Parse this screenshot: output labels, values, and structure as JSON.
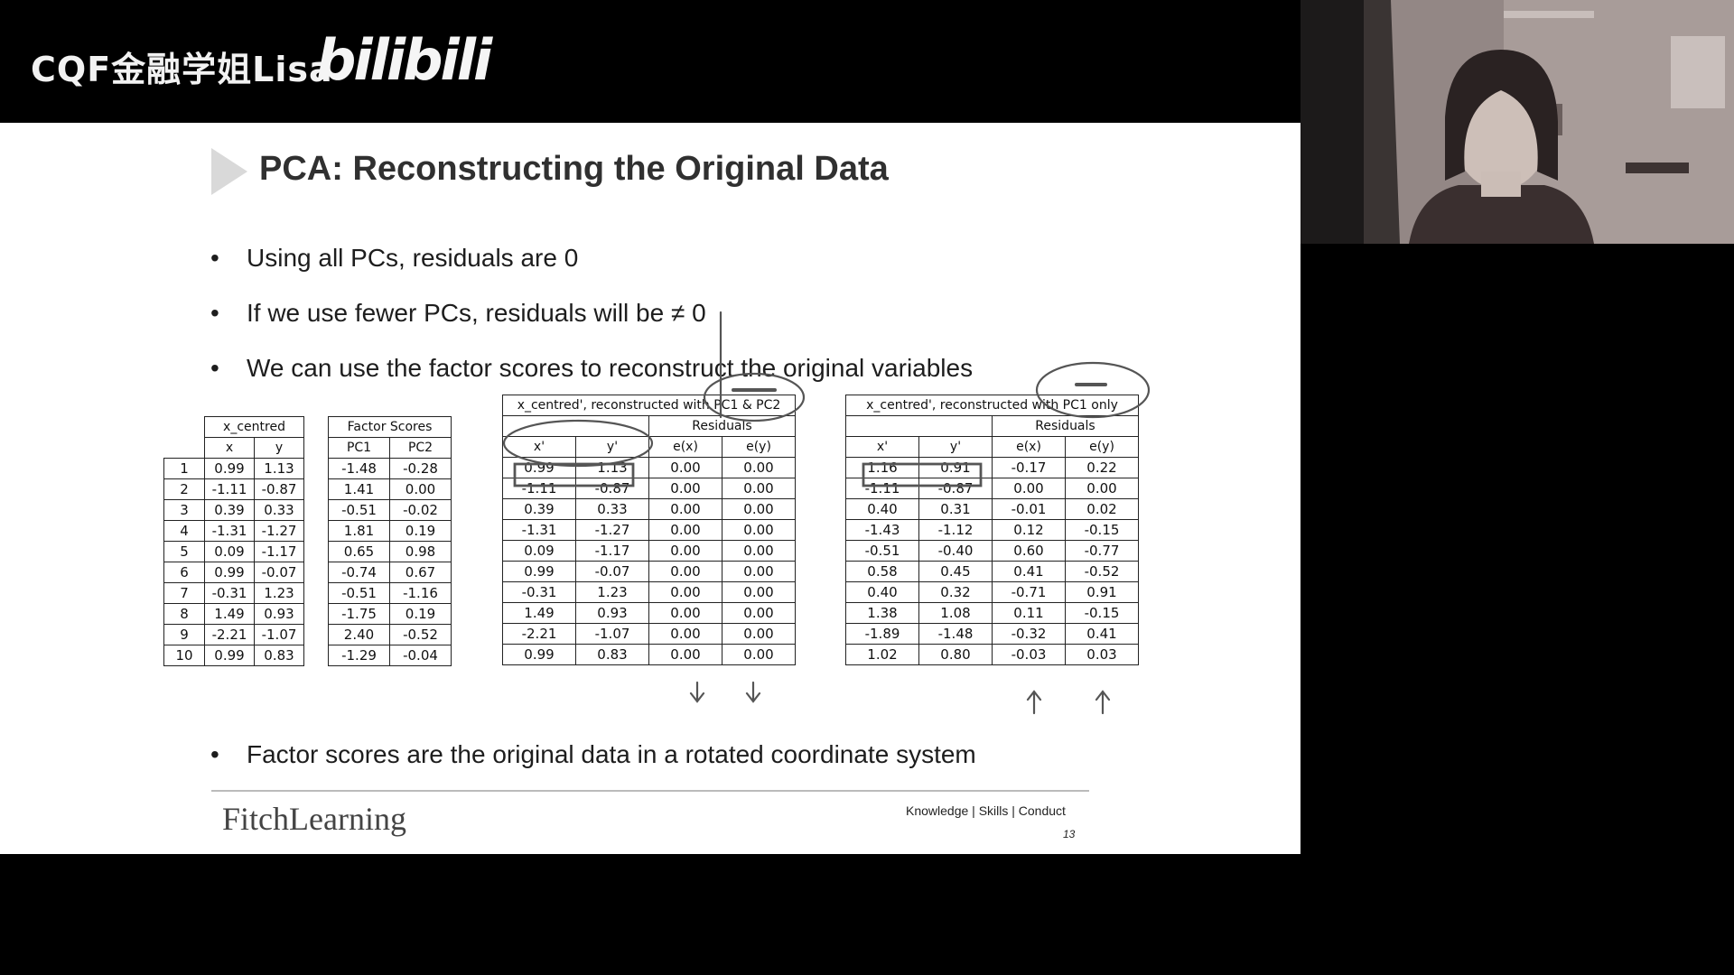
{
  "overlay": {
    "channel": "CQF金融学姐Lisa",
    "platform": "bilibili"
  },
  "slide": {
    "title": "PCA: Reconstructing the Original Data",
    "bullets": [
      "Using all PCs, residuals are 0",
      "If we use fewer PCs, residuals will be ≠ 0",
      "We can use the factor scores to reconstruct the original variables",
      "Factor scores are the original data in a rotated coordinate system"
    ],
    "footer": {
      "logo": "FitchLearning",
      "tagline": "Knowledge | Skills | Conduct",
      "page": "13"
    }
  },
  "tables": {
    "x_centred": {
      "title": "x_centred",
      "headers": [
        "x",
        "y"
      ],
      "rows": [
        [
          "1",
          "0.99",
          "1.13"
        ],
        [
          "2",
          "-1.11",
          "-0.87"
        ],
        [
          "3",
          "0.39",
          "0.33"
        ],
        [
          "4",
          "-1.31",
          "-1.27"
        ],
        [
          "5",
          "0.09",
          "-1.17"
        ],
        [
          "6",
          "0.99",
          "-0.07"
        ],
        [
          "7",
          "-0.31",
          "1.23"
        ],
        [
          "8",
          "1.49",
          "0.93"
        ],
        [
          "9",
          "-2.21",
          "-1.07"
        ],
        [
          "10",
          "0.99",
          "0.83"
        ]
      ]
    },
    "factor_scores": {
      "title": "Factor Scores",
      "headers": [
        "PC1",
        "PC2"
      ],
      "rows": [
        [
          "-1.48",
          "-0.28"
        ],
        [
          "1.41",
          "0.00"
        ],
        [
          "-0.51",
          "-0.02"
        ],
        [
          "1.81",
          "0.19"
        ],
        [
          "0.65",
          "0.98"
        ],
        [
          "-0.74",
          "0.67"
        ],
        [
          "-0.51",
          "-1.16"
        ],
        [
          "-1.75",
          "0.19"
        ],
        [
          "2.40",
          "-0.52"
        ],
        [
          "-1.29",
          "-0.04"
        ]
      ]
    },
    "recon_pc12": {
      "title": "x_centred', reconstructed with PC1 & PC2",
      "sub": "Residuals",
      "headers": [
        "x'",
        "y'",
        "e(x)",
        "e(y)"
      ],
      "rows": [
        [
          "0.99",
          "1.13",
          "0.00",
          "0.00"
        ],
        [
          "-1.11",
          "-0.87",
          "0.00",
          "0.00"
        ],
        [
          "0.39",
          "0.33",
          "0.00",
          "0.00"
        ],
        [
          "-1.31",
          "-1.27",
          "0.00",
          "0.00"
        ],
        [
          "0.09",
          "-1.17",
          "0.00",
          "0.00"
        ],
        [
          "0.99",
          "-0.07",
          "0.00",
          "0.00"
        ],
        [
          "-0.31",
          "1.23",
          "0.00",
          "0.00"
        ],
        [
          "1.49",
          "0.93",
          "0.00",
          "0.00"
        ],
        [
          "-2.21",
          "-1.07",
          "0.00",
          "0.00"
        ],
        [
          "0.99",
          "0.83",
          "0.00",
          "0.00"
        ]
      ]
    },
    "recon_pc1": {
      "title": "x_centred', reconstructed with PC1 only",
      "sub": "Residuals",
      "headers": [
        "x'",
        "y'",
        "e(x)",
        "e(y)"
      ],
      "rows": [
        [
          "1.16",
          "0.91",
          "-0.17",
          "0.22"
        ],
        [
          "-1.11",
          "-0.87",
          "0.00",
          "0.00"
        ],
        [
          "0.40",
          "0.31",
          "-0.01",
          "0.02"
        ],
        [
          "-1.43",
          "-1.12",
          "0.12",
          "-0.15"
        ],
        [
          "-0.51",
          "-0.40",
          "0.60",
          "-0.77"
        ],
        [
          "0.58",
          "0.45",
          "0.41",
          "-0.52"
        ],
        [
          "0.40",
          "0.32",
          "-0.71",
          "0.91"
        ],
        [
          "1.38",
          "1.08",
          "0.11",
          "-0.15"
        ],
        [
          "-1.89",
          "-1.48",
          "-0.32",
          "0.41"
        ],
        [
          "1.02",
          "0.80",
          "-0.03",
          "0.03"
        ]
      ]
    }
  }
}
